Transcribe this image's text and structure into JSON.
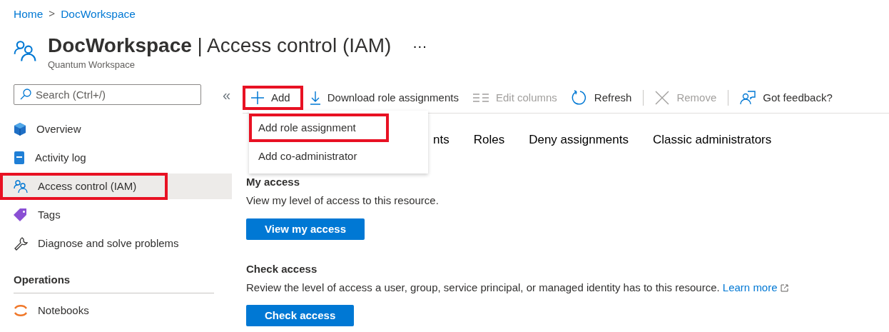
{
  "breadcrumb": [
    "Home",
    "DocWorkspace"
  ],
  "breadcrumb_separator": ">",
  "header": {
    "resource": "DocWorkspace",
    "divider": "|",
    "title": "Access control (IAM)",
    "subtitle": "Quantum Workspace",
    "more": "···"
  },
  "search": {
    "placeholder": "Search (Ctrl+/)"
  },
  "collapse": "«",
  "sidebar": {
    "items": [
      {
        "label": "Overview",
        "kind": "cube",
        "selected": false,
        "highlighted": false
      },
      {
        "label": "Activity log",
        "kind": "book",
        "selected": false,
        "highlighted": false
      },
      {
        "label": "Access control (IAM)",
        "kind": "people",
        "selected": true,
        "highlighted": true
      },
      {
        "label": "Tags",
        "kind": "tag",
        "selected": false,
        "highlighted": false
      },
      {
        "label": "Diagnose and solve problems",
        "kind": "wrench",
        "selected": false,
        "highlighted": false
      }
    ],
    "sections": [
      {
        "title": "Operations",
        "items": [
          {
            "label": "Notebooks",
            "kind": "arc",
            "selected": false,
            "highlighted": false
          }
        ]
      }
    ]
  },
  "toolbar": [
    {
      "label": "Add",
      "kind": "plus",
      "disabled": false,
      "highlighted": true,
      "separator_before": false
    },
    {
      "label": "Download role assignments",
      "kind": "download",
      "disabled": false,
      "highlighted": false,
      "separator_before": false
    },
    {
      "label": "Edit columns",
      "kind": "columns",
      "disabled": true,
      "highlighted": false,
      "separator_before": false
    },
    {
      "label": "Refresh",
      "kind": "refresh",
      "disabled": false,
      "highlighted": false,
      "separator_before": false
    },
    {
      "label": "Remove",
      "kind": "close",
      "disabled": true,
      "highlighted": false,
      "separator_before": true
    },
    {
      "label": "Got feedback?",
      "kind": "feedback",
      "disabled": false,
      "highlighted": false,
      "separator_before": true
    }
  ],
  "add_menu": {
    "items": [
      {
        "label": "Add role assignment",
        "highlighted": true
      },
      {
        "label": "Add co-administrator",
        "highlighted": false
      }
    ]
  },
  "tabs": [
    "nts",
    "Roles",
    "Deny assignments",
    "Classic administrators"
  ],
  "sections": [
    {
      "title": "My access",
      "text": "View my level of access to this resource.",
      "button": "View my access"
    },
    {
      "title": "Check access",
      "text": "Review the level of access a user, group, service principal, or managed identity has to this resource.",
      "link": "Learn more",
      "button": "Check access"
    }
  ]
}
